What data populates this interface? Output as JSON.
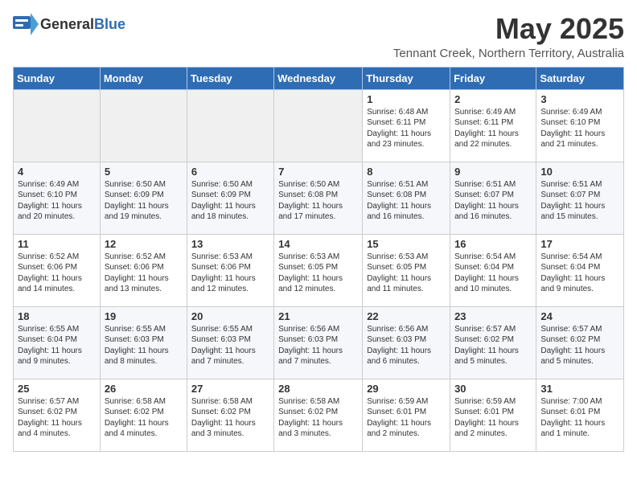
{
  "logo": {
    "general": "General",
    "blue": "Blue"
  },
  "header": {
    "month": "May 2025",
    "location": "Tennant Creek, Northern Territory, Australia"
  },
  "weekdays": [
    "Sunday",
    "Monday",
    "Tuesday",
    "Wednesday",
    "Thursday",
    "Friday",
    "Saturday"
  ],
  "weeks": [
    [
      {
        "day": "",
        "content": ""
      },
      {
        "day": "",
        "content": ""
      },
      {
        "day": "",
        "content": ""
      },
      {
        "day": "",
        "content": ""
      },
      {
        "day": "1",
        "content": "Sunrise: 6:48 AM\nSunset: 6:11 PM\nDaylight: 11 hours\nand 23 minutes."
      },
      {
        "day": "2",
        "content": "Sunrise: 6:49 AM\nSunset: 6:11 PM\nDaylight: 11 hours\nand 22 minutes."
      },
      {
        "day": "3",
        "content": "Sunrise: 6:49 AM\nSunset: 6:10 PM\nDaylight: 11 hours\nand 21 minutes."
      }
    ],
    [
      {
        "day": "4",
        "content": "Sunrise: 6:49 AM\nSunset: 6:10 PM\nDaylight: 11 hours\nand 20 minutes."
      },
      {
        "day": "5",
        "content": "Sunrise: 6:50 AM\nSunset: 6:09 PM\nDaylight: 11 hours\nand 19 minutes."
      },
      {
        "day": "6",
        "content": "Sunrise: 6:50 AM\nSunset: 6:09 PM\nDaylight: 11 hours\nand 18 minutes."
      },
      {
        "day": "7",
        "content": "Sunrise: 6:50 AM\nSunset: 6:08 PM\nDaylight: 11 hours\nand 17 minutes."
      },
      {
        "day": "8",
        "content": "Sunrise: 6:51 AM\nSunset: 6:08 PM\nDaylight: 11 hours\nand 16 minutes."
      },
      {
        "day": "9",
        "content": "Sunrise: 6:51 AM\nSunset: 6:07 PM\nDaylight: 11 hours\nand 16 minutes."
      },
      {
        "day": "10",
        "content": "Sunrise: 6:51 AM\nSunset: 6:07 PM\nDaylight: 11 hours\nand 15 minutes."
      }
    ],
    [
      {
        "day": "11",
        "content": "Sunrise: 6:52 AM\nSunset: 6:06 PM\nDaylight: 11 hours\nand 14 minutes."
      },
      {
        "day": "12",
        "content": "Sunrise: 6:52 AM\nSunset: 6:06 PM\nDaylight: 11 hours\nand 13 minutes."
      },
      {
        "day": "13",
        "content": "Sunrise: 6:53 AM\nSunset: 6:06 PM\nDaylight: 11 hours\nand 12 minutes."
      },
      {
        "day": "14",
        "content": "Sunrise: 6:53 AM\nSunset: 6:05 PM\nDaylight: 11 hours\nand 12 minutes."
      },
      {
        "day": "15",
        "content": "Sunrise: 6:53 AM\nSunset: 6:05 PM\nDaylight: 11 hours\nand 11 minutes."
      },
      {
        "day": "16",
        "content": "Sunrise: 6:54 AM\nSunset: 6:04 PM\nDaylight: 11 hours\nand 10 minutes."
      },
      {
        "day": "17",
        "content": "Sunrise: 6:54 AM\nSunset: 6:04 PM\nDaylight: 11 hours\nand 9 minutes."
      }
    ],
    [
      {
        "day": "18",
        "content": "Sunrise: 6:55 AM\nSunset: 6:04 PM\nDaylight: 11 hours\nand 9 minutes."
      },
      {
        "day": "19",
        "content": "Sunrise: 6:55 AM\nSunset: 6:03 PM\nDaylight: 11 hours\nand 8 minutes."
      },
      {
        "day": "20",
        "content": "Sunrise: 6:55 AM\nSunset: 6:03 PM\nDaylight: 11 hours\nand 7 minutes."
      },
      {
        "day": "21",
        "content": "Sunrise: 6:56 AM\nSunset: 6:03 PM\nDaylight: 11 hours\nand 7 minutes."
      },
      {
        "day": "22",
        "content": "Sunrise: 6:56 AM\nSunset: 6:03 PM\nDaylight: 11 hours\nand 6 minutes."
      },
      {
        "day": "23",
        "content": "Sunrise: 6:57 AM\nSunset: 6:02 PM\nDaylight: 11 hours\nand 5 minutes."
      },
      {
        "day": "24",
        "content": "Sunrise: 6:57 AM\nSunset: 6:02 PM\nDaylight: 11 hours\nand 5 minutes."
      }
    ],
    [
      {
        "day": "25",
        "content": "Sunrise: 6:57 AM\nSunset: 6:02 PM\nDaylight: 11 hours\nand 4 minutes."
      },
      {
        "day": "26",
        "content": "Sunrise: 6:58 AM\nSunset: 6:02 PM\nDaylight: 11 hours\nand 4 minutes."
      },
      {
        "day": "27",
        "content": "Sunrise: 6:58 AM\nSunset: 6:02 PM\nDaylight: 11 hours\nand 3 minutes."
      },
      {
        "day": "28",
        "content": "Sunrise: 6:58 AM\nSunset: 6:02 PM\nDaylight: 11 hours\nand 3 minutes."
      },
      {
        "day": "29",
        "content": "Sunrise: 6:59 AM\nSunset: 6:01 PM\nDaylight: 11 hours\nand 2 minutes."
      },
      {
        "day": "30",
        "content": "Sunrise: 6:59 AM\nSunset: 6:01 PM\nDaylight: 11 hours\nand 2 minutes."
      },
      {
        "day": "31",
        "content": "Sunrise: 7:00 AM\nSunset: 6:01 PM\nDaylight: 11 hours\nand 1 minute."
      }
    ]
  ]
}
